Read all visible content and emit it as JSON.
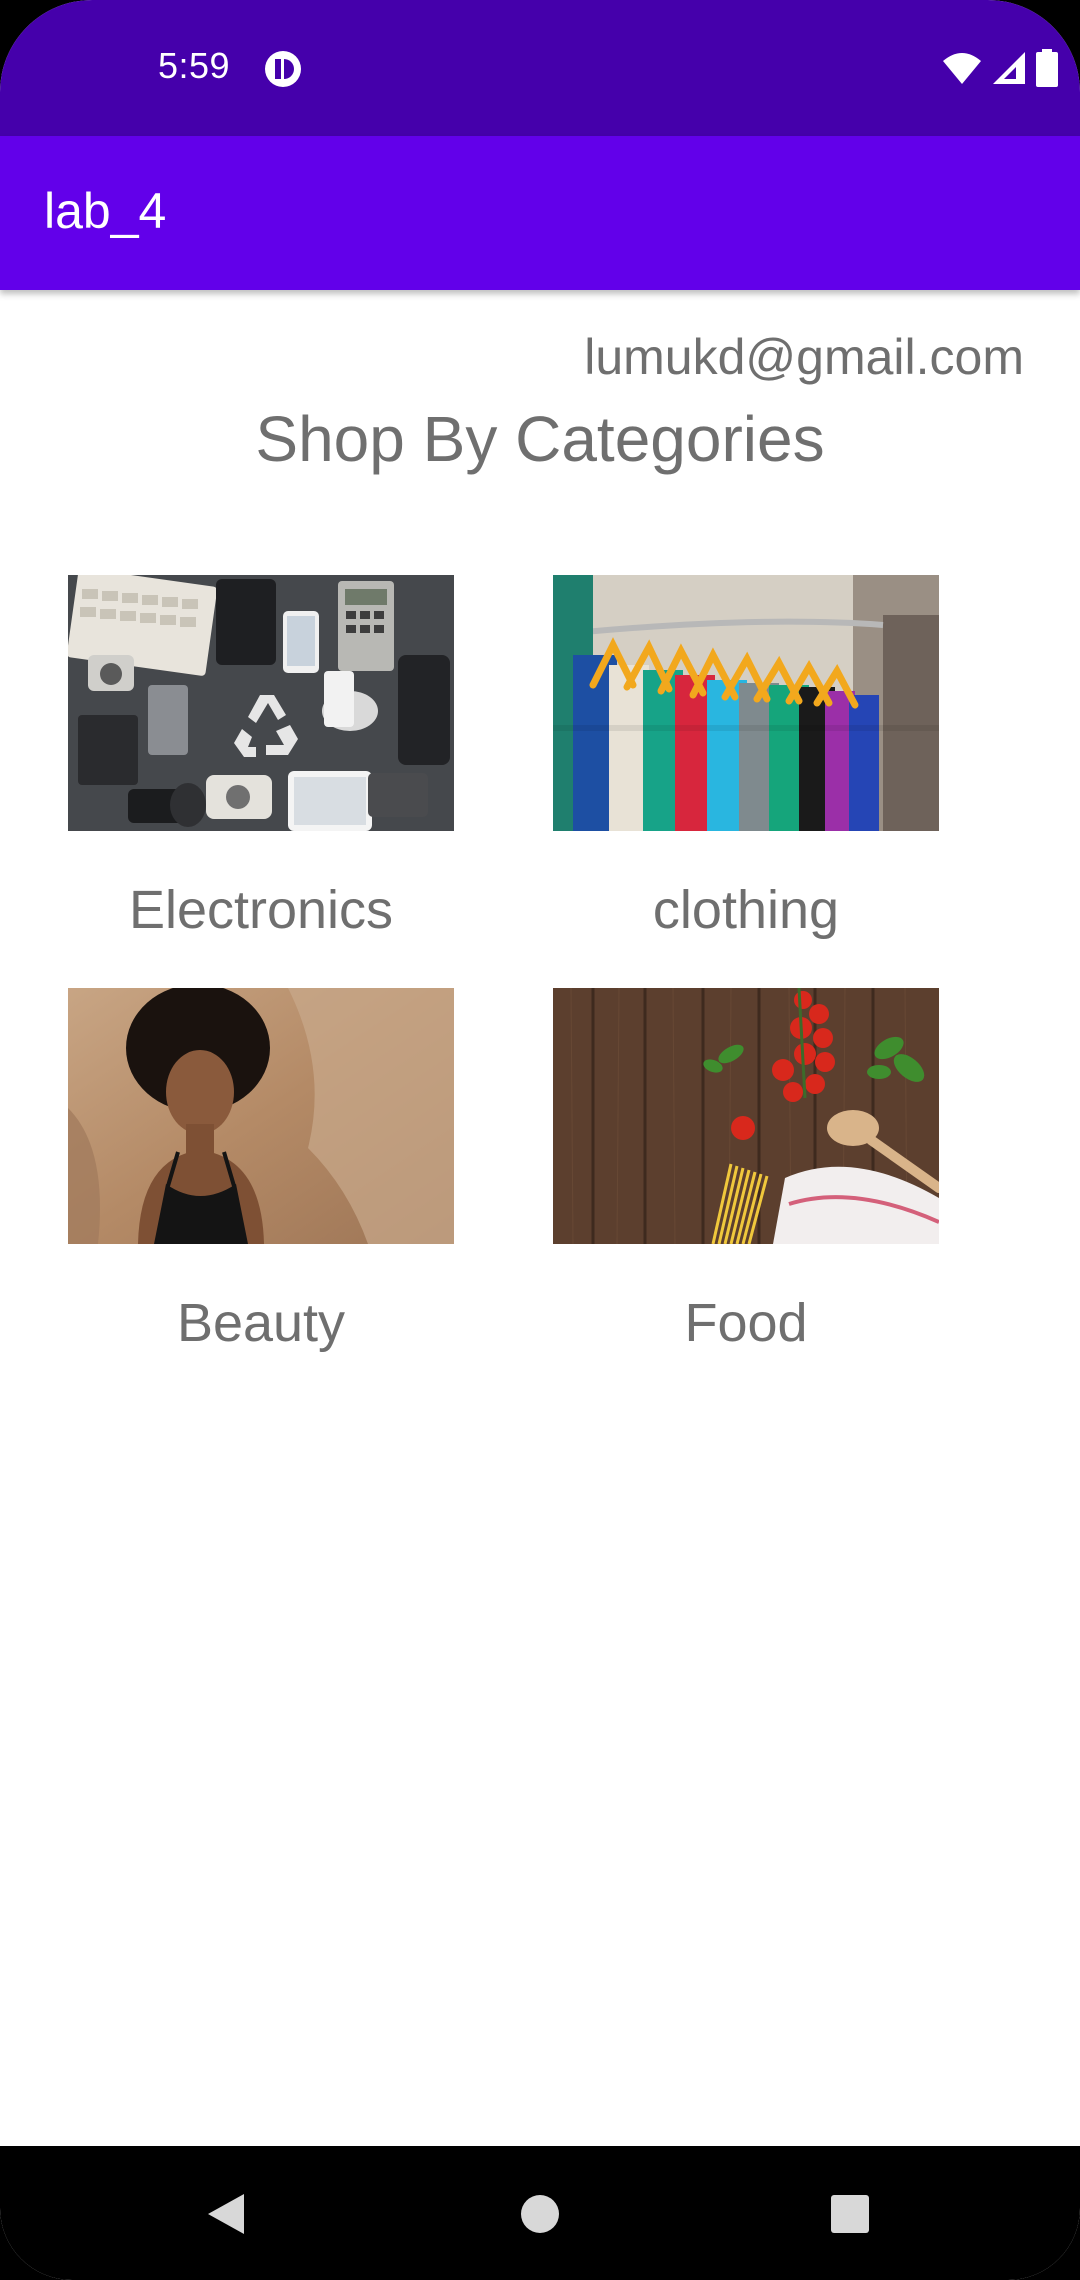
{
  "status_bar": {
    "time": "5:59",
    "app_icon": "notification-app-icon",
    "icons": [
      "wifi-icon",
      "signal-icon",
      "battery-icon"
    ],
    "background": "#4500ab"
  },
  "app_bar": {
    "title": "lab_4",
    "background": "#6200ea"
  },
  "main": {
    "email": "lumukd@gmail.com",
    "heading": "Shop By Categories",
    "categories": [
      {
        "label": "Electronics",
        "image": "electronics-photo"
      },
      {
        "label": "clothing",
        "image": "clothing-photo"
      },
      {
        "label": "Beauty",
        "image": "beauty-photo"
      },
      {
        "label": "Food",
        "image": "food-photo"
      }
    ]
  },
  "nav_bar": {
    "buttons": [
      "back-icon",
      "home-icon",
      "recents-icon"
    ]
  }
}
